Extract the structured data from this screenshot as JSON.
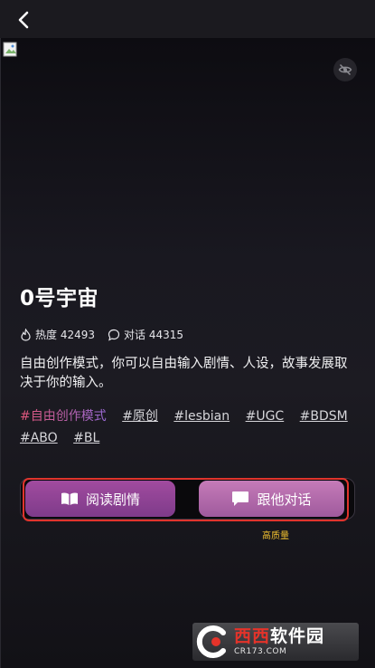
{
  "story": {
    "title": "0号宇宙",
    "heat_label": "热度",
    "heat_value": "42493",
    "chat_label": "对话",
    "chat_value": "44315",
    "description": "自由创作模式，你可以自由输入剧情、人设，故事发展取决于你的输入。",
    "tags": [
      "#自由创作模式",
      "#原创",
      "#lesbian",
      "#UGC",
      "#BDSM",
      "#ABO",
      "#BL"
    ]
  },
  "actions": {
    "read_label": "阅读剧情",
    "chat_label": "跟他对话",
    "quality_note": "高质量"
  },
  "watermark": {
    "brand_red": "西西",
    "brand_white": "软件园",
    "url": "CR173.COM"
  },
  "colors": {
    "accent_purple": "#a14b9f",
    "accent_pink": "#c57bb8",
    "highlight_red": "#e0342d",
    "quality_gold": "#f0c030"
  }
}
